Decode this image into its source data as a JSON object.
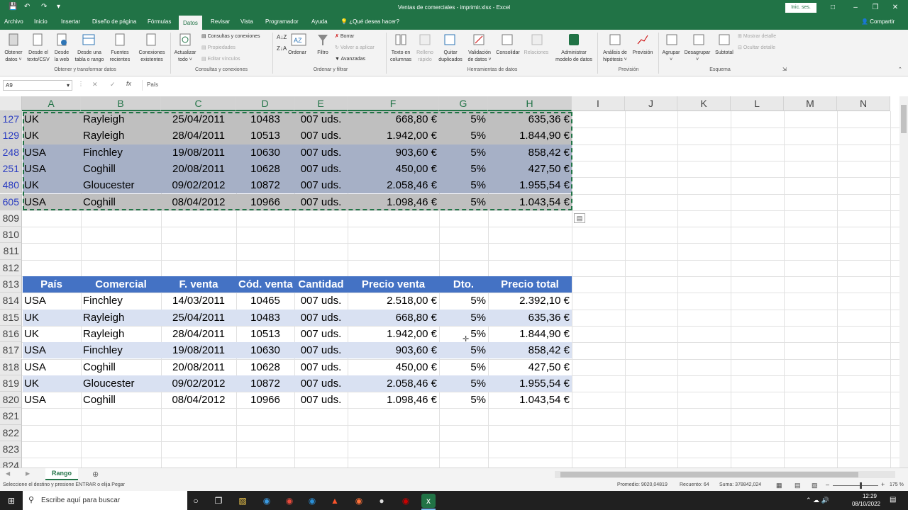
{
  "window": {
    "title": "Ventas de comerciales - imprimir.xlsx  -  Excel",
    "signin_label": "Inic. ses.",
    "share_label": "Compartir"
  },
  "tabs": [
    "Archivo",
    "Inicio",
    "Insertar",
    "Diseño de página",
    "Fórmulas",
    "Datos",
    "Revisar",
    "Vista",
    "Programador",
    "Ayuda"
  ],
  "active_tab": "Datos",
  "tell_me": "¿Qué desea hacer?",
  "ribbon": {
    "buttons": {
      "obtener": [
        "Obtener",
        "datos ˅"
      ],
      "texto_csv": [
        "Desde el",
        "texto/CSV"
      ],
      "web": [
        "Desde",
        "la web"
      ],
      "tabla": [
        "Desde una",
        "tabla o rango"
      ],
      "fuentes": [
        "Fuentes",
        "recientes"
      ],
      "conexiones": [
        "Conexiones",
        "existentes"
      ],
      "actualizar": [
        "Actualizar",
        "todo ˅"
      ],
      "consultas": "Consultas y conexiones",
      "propiedades": "Propiedades",
      "editar_vinculos": "Editar vínculos",
      "ordenar": "Ordenar",
      "filtro": "Filtro",
      "borrar": "Borrar",
      "volver": "Volver a aplicar",
      "avanzadas": "Avanzadas",
      "texto_columnas": [
        "Texto en",
        "columnas"
      ],
      "relleno": [
        "Relleno",
        "rápido"
      ],
      "quitar_dup": [
        "Quitar",
        "duplicados"
      ],
      "validacion": [
        "Validación",
        "de datos ˅"
      ],
      "consolidar": "Consolidar",
      "relaciones": "Relaciones",
      "modelo": [
        "Administrar",
        "modelo de datos"
      ],
      "hipotesis": [
        "Análisis de",
        "hipótesis ˅"
      ],
      "prevision": [
        "Previsión",
        ""
      ],
      "agrupar": [
        "Agrupar",
        "˅"
      ],
      "desagrupar": [
        "Desagrupar",
        "˅"
      ],
      "subtotal": "Subtotal",
      "mostrar_detalle": "Mostrar detalle",
      "ocultar_detalle": "Ocultar detalle"
    },
    "groups": {
      "obtener": "Obtener y transformar datos",
      "consultas": "Consultas y conexiones",
      "ordenar": "Ordenar y filtrar",
      "herramientas": "Herramientas de datos",
      "prevision": "Previsión",
      "esquema": "Esquema"
    }
  },
  "formula_bar": {
    "name_box": "A9",
    "fx": "fx",
    "value": "País"
  },
  "columns": [
    "A",
    "B",
    "C",
    "D",
    "E",
    "F",
    "G",
    "H",
    "I",
    "J",
    "K",
    "L",
    "M",
    "N"
  ],
  "copied_rows": [
    {
      "row": "127",
      "cells": [
        "UK",
        "Rayleigh",
        "25/04/2011",
        "10483",
        "007 uds.",
        "668,80 €",
        "5%",
        "635,36 €"
      ]
    },
    {
      "row": "129",
      "cells": [
        "UK",
        "Rayleigh",
        "28/04/2011",
        "10513",
        "007 uds.",
        "1.942,00 €",
        "5%",
        "1.844,90 €"
      ]
    },
    {
      "row": "248",
      "cells": [
        "USA",
        "Finchley",
        "19/08/2011",
        "10630",
        "007 uds.",
        "903,60 €",
        "5%",
        "858,42 €"
      ]
    },
    {
      "row": "251",
      "cells": [
        "USA",
        "Coghill",
        "20/08/2011",
        "10628",
        "007 uds.",
        "450,00 €",
        "5%",
        "427,50 €"
      ]
    },
    {
      "row": "480",
      "cells": [
        "UK",
        "Gloucester",
        "09/02/2012",
        "10872",
        "007 uds.",
        "2.058,46 €",
        "5%",
        "1.955,54 €"
      ]
    },
    {
      "row": "605",
      "cells": [
        "USA",
        "Coghill",
        "08/04/2012",
        "10966",
        "007 uds.",
        "1.098,46 €",
        "5%",
        "1.043,54 €"
      ]
    }
  ],
  "empty_rows": [
    "809",
    "810",
    "811",
    "812"
  ],
  "header_row": {
    "row": "813",
    "cells": [
      "País",
      "Comercial",
      "F. venta",
      "Cód. venta",
      "Cantidad",
      "Precio venta",
      "Dto.",
      "Precio total"
    ]
  },
  "data_rows": [
    {
      "row": "814",
      "cells": [
        "USA",
        "Finchley",
        "14/03/2011",
        "10465",
        "007 uds.",
        "2.518,00 €",
        "5%",
        "2.392,10 €"
      ]
    },
    {
      "row": "815",
      "cells": [
        "UK",
        "Rayleigh",
        "25/04/2011",
        "10483",
        "007 uds.",
        "668,80 €",
        "5%",
        "635,36 €"
      ]
    },
    {
      "row": "816",
      "cells": [
        "UK",
        "Rayleigh",
        "28/04/2011",
        "10513",
        "007 uds.",
        "1.942,00 €",
        "5%",
        "1.844,90 €"
      ]
    },
    {
      "row": "817",
      "cells": [
        "USA",
        "Finchley",
        "19/08/2011",
        "10630",
        "007 uds.",
        "903,60 €",
        "5%",
        "858,42 €"
      ]
    },
    {
      "row": "818",
      "cells": [
        "USA",
        "Coghill",
        "20/08/2011",
        "10628",
        "007 uds.",
        "450,00 €",
        "5%",
        "427,50 €"
      ]
    },
    {
      "row": "819",
      "cells": [
        "UK",
        "Gloucester",
        "09/02/2012",
        "10872",
        "007 uds.",
        "2.058,46 €",
        "5%",
        "1.955,54 €"
      ]
    },
    {
      "row": "820",
      "cells": [
        "USA",
        "Coghill",
        "08/04/2012",
        "10966",
        "007 uds.",
        "1.098,46 €",
        "5%",
        "1.043,54 €"
      ]
    }
  ],
  "trailing_rows": [
    "821",
    "822",
    "823",
    "824"
  ],
  "sheet_tab": "Rango",
  "status": {
    "message": "Seleccione el destino y presione ENTRAR o elija Pegar",
    "promedio": "Promedio: 9020,04819",
    "recuento": "Recuento: 64",
    "suma": "Suma: 378842,024",
    "zoom": "175 %"
  },
  "taskbar": {
    "search_placeholder": "Escribe aquí para buscar",
    "time": "12:29",
    "date": "08/10/2022"
  },
  "colors": {
    "excel_green": "#217346",
    "header_blue": "#4472c4",
    "band_blue": "#d9e1f2",
    "copied_gray": "#bfbfbf",
    "copied_blue": "#a6b0c6"
  }
}
